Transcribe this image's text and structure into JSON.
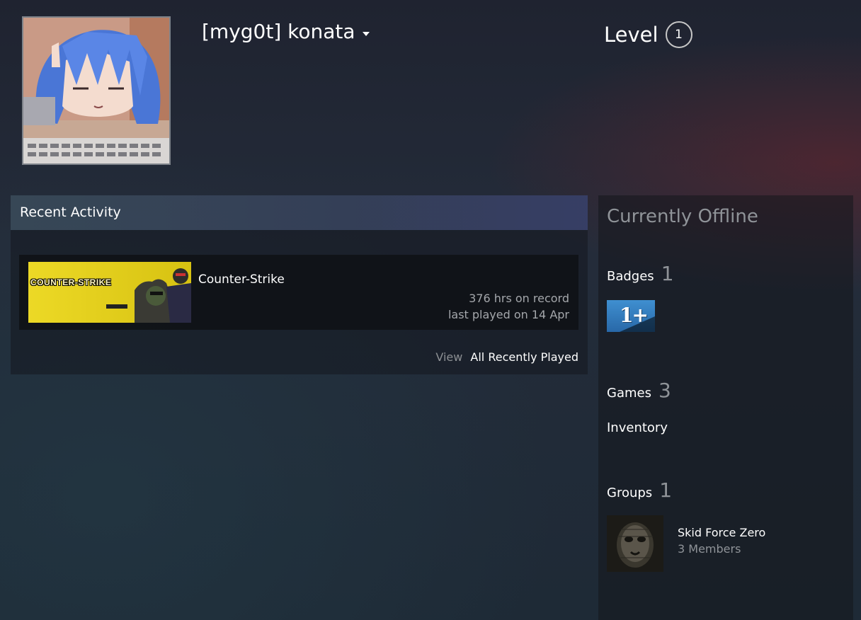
{
  "profile": {
    "persona_name": "[myg0t] konata",
    "level_label": "Level",
    "level_value": "1",
    "avatar_icon": "anime-avatar"
  },
  "recent_activity": {
    "title": "Recent Activity",
    "games": [
      {
        "name": "Counter-Strike",
        "capsule_icon": "counter-strike-capsule",
        "capsule_text": "COUNTER-STRIKE",
        "hours": "376 hrs on record",
        "last_played": "last played on 14 Apr"
      }
    ],
    "view_label": "View",
    "view_link": "All Recently Played"
  },
  "sidebar": {
    "status": "Currently Offline",
    "badges": {
      "label": "Badges",
      "count": "1",
      "badge_icon": "years-of-service-badge",
      "badge_text": "1+"
    },
    "games": {
      "label": "Games",
      "count": "3"
    },
    "inventory": {
      "label": "Inventory"
    },
    "groups": {
      "label": "Groups",
      "count": "1",
      "items": [
        {
          "name": "Skid Force Zero",
          "members": "3 Members",
          "avatar_icon": "group-avatar"
        }
      ]
    }
  },
  "colors": {
    "status_gray": "#8f9398",
    "badge_blue": "#3f8fd0",
    "capsule_yellow": "#e7d21b"
  }
}
